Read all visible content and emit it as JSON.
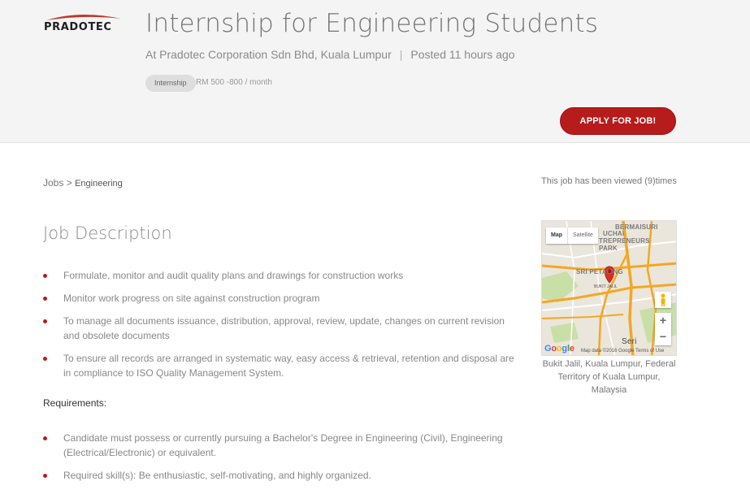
{
  "brand": {
    "logo_text": "PRADOTEC"
  },
  "job": {
    "title": "Internship for Engineering Students",
    "company_line": "At Pradotec Corporation Sdn Bhd, Kuala Lumpur",
    "separator": "|",
    "posted": "Posted 11 hours ago",
    "tag": "Internship",
    "salary": "RM 500 -800 / month",
    "apply_label": "APPLY FOR JOB!"
  },
  "breadcrumb": {
    "root": "Jobs",
    "separator": ">",
    "current": "Engineering"
  },
  "views_text": "This job has been viewed (9)times",
  "description": {
    "heading": "Job Description",
    "items": [
      "Formulate, monitor and audit quality plans and drawings for construction works",
      "Monitor work progress on site against construction program",
      "To manage all documents issuance, distribution, approval, review, update, changes on current revision and obsolete documents",
      "To ensure all records are arranged in systematic way, easy access & retrieval, retention and disposal are in compliance to ISO Quality Management System."
    ]
  },
  "requirements": {
    "heading": "Requirements:",
    "items": [
      "Candidate must possess or currently pursuing a Bachelor's Degree in Engineering (Civil), Engineering (Electrical/Electronic) or equivalent.",
      "Required skill(s): Be enthusiastic, self-motivating, and highly organized."
    ]
  },
  "map": {
    "tab_map": "Map",
    "tab_satellite": "Satellite",
    "labels": {
      "bermaisuri": "BERMAISURI",
      "uchai": "UCHAI",
      "trepreneurs": "TREPRENEURS",
      "park": "PARK",
      "sri_petaling": "SRI PETALING",
      "bukit_jalil": "BUKIT JALIL",
      "seri": "Seri"
    },
    "zoom_in": "+",
    "zoom_out": "−",
    "google": [
      "G",
      "o",
      "o",
      "g",
      "l",
      "e"
    ],
    "footer": "Map data ©2016 Google  Terms of Use",
    "colors": {
      "road_major": "#f5a623",
      "road_minor": "#ffffff",
      "park": "#c8dfa8",
      "water": "#a9c9f0",
      "pin": "#d93025"
    }
  },
  "location": {
    "line1": "Bukit Jalil, Kuala Lumpur, Federal",
    "line2": "Territory of Kuala Lumpur,",
    "line3": "Malaysia"
  },
  "colors": {
    "accent": "#b71c1c",
    "header_bg": "#f4f4f4"
  }
}
